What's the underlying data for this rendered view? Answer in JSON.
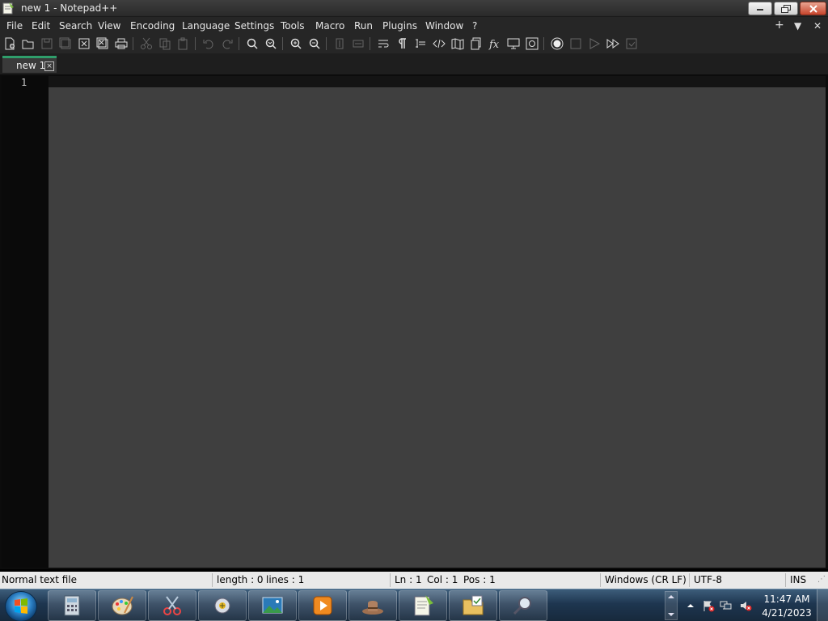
{
  "window": {
    "title": "new 1 - Notepad++"
  },
  "menu": {
    "items": [
      "File",
      "Edit",
      "Search",
      "View",
      "Encoding",
      "Language",
      "Settings",
      "Tools",
      "Macro",
      "Run",
      "Plugins",
      "Window",
      "?"
    ],
    "extra": {
      "plus": "+",
      "dropdown": "▼",
      "close": "✕"
    }
  },
  "toolbar": {
    "icons": [
      "new-file-icon",
      "open-file-icon",
      "save-icon",
      "save-all-icon",
      "close-icon",
      "close-all-icon",
      "print-icon",
      "cut-icon",
      "copy-icon",
      "paste-icon",
      "undo-icon",
      "redo-icon",
      "find-icon",
      "replace-icon",
      "zoom-in-icon",
      "zoom-out-icon",
      "sync-vertical-icon",
      "sync-horizontal-icon",
      "word-wrap-icon",
      "show-all-chars-icon",
      "indent-guide-icon",
      "xml-tag-icon",
      "document-map-icon",
      "document-list-icon",
      "function-list-icon",
      "folder-workspace-icon",
      "monitoring-icon",
      "record-macro-icon",
      "stop-record-icon",
      "play-macro-icon",
      "run-macro-multiple-icon",
      "save-macro-icon"
    ]
  },
  "tabs": [
    {
      "label": "new 1",
      "close": "×"
    }
  ],
  "editor": {
    "line_numbers": [
      "1"
    ]
  },
  "statusbar": {
    "file_type": "Normal text file",
    "length": "length : 0",
    "lines": "lines : 1",
    "ln": "Ln : 1",
    "col": "Col : 1",
    "pos": "Pos : 1",
    "eol": "Windows (CR LF)",
    "encoding": "UTF-8",
    "mode": "INS"
  },
  "taskbar": {
    "apps": [
      "calculator",
      "paint",
      "snipping-tool",
      "game-controller",
      "photo-viewer",
      "media-player",
      "hat-app",
      "notepad-plus-plus",
      "file-manager",
      "magnifier-app"
    ],
    "clock_time": "11:47 AM",
    "clock_date": "4/21/2023"
  }
}
